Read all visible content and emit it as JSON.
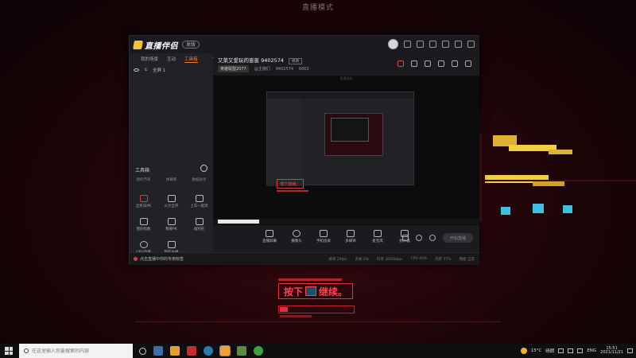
{
  "desktop": {
    "mode_title": "直播模式",
    "prompt_text": "按下",
    "prompt_text2": "继续。",
    "pc_label": "PC"
  },
  "app": {
    "name": "直播伴侣",
    "version_badge": "发版",
    "left_tabs": [
      "我的场景",
      "互动",
      "工具箱"
    ],
    "scene": {
      "index": "①",
      "name": "全屏 1"
    },
    "toolbox_heading": "工具箱",
    "tools_top": [
      "我的节目",
      "弹幕库",
      "数据助手"
    ],
    "tools": [
      {
        "label": "全民乐PK",
        "icon": "shield-pk-icon"
      },
      {
        "label": "火力全开",
        "icon": "fire-icon"
      },
      {
        "label": "上车一起玩",
        "icon": "car-icon"
      },
      {
        "label": "我的指数",
        "icon": "chart-icon"
      },
      {
        "label": "我要PK",
        "icon": "house-icon"
      },
      {
        "label": "福利社",
        "icon": "gift-icon"
      },
      {
        "label": "OBS直播",
        "icon": "obs-icon"
      },
      {
        "label": "我的主播",
        "icon": "download-icon"
      }
    ],
    "room": {
      "title": "又菜又爱玩的崽崽 9402574",
      "edit_label": "修改",
      "category": "英雄联盟2077",
      "room_id": "9402574",
      "fans": "6002",
      "owner": "@主播们"
    },
    "preview": {
      "label": "直播画面",
      "nested_button": "按下继续。"
    },
    "controls": [
      {
        "label": "直播屏幕",
        "icon": "screen-icon"
      },
      {
        "label": "摄像头",
        "icon": "camera-icon"
      },
      {
        "label": "手机投屏",
        "icon": "phone-cast-icon"
      },
      {
        "label": "多媒体",
        "icon": "media-icon"
      },
      {
        "label": "麦克风",
        "icon": "mic-icon"
      },
      {
        "label": "扬声器",
        "icon": "speaker-icon"
      }
    ],
    "live_button": "开始直播",
    "status_message": "点击直播中你的专用标签",
    "stats": [
      "帧率 29fps",
      "丢帧 0%",
      "码率 3000kbps",
      "CPU 40%",
      "内存 57%",
      "网络 正常"
    ]
  },
  "taskbar": {
    "search_placeholder": "在这里输入你要搜索的内容",
    "weather": "15°C",
    "weather_desc": "晴朗",
    "lang": "ENG",
    "time": "15:51",
    "date": "2021/11/21"
  }
}
